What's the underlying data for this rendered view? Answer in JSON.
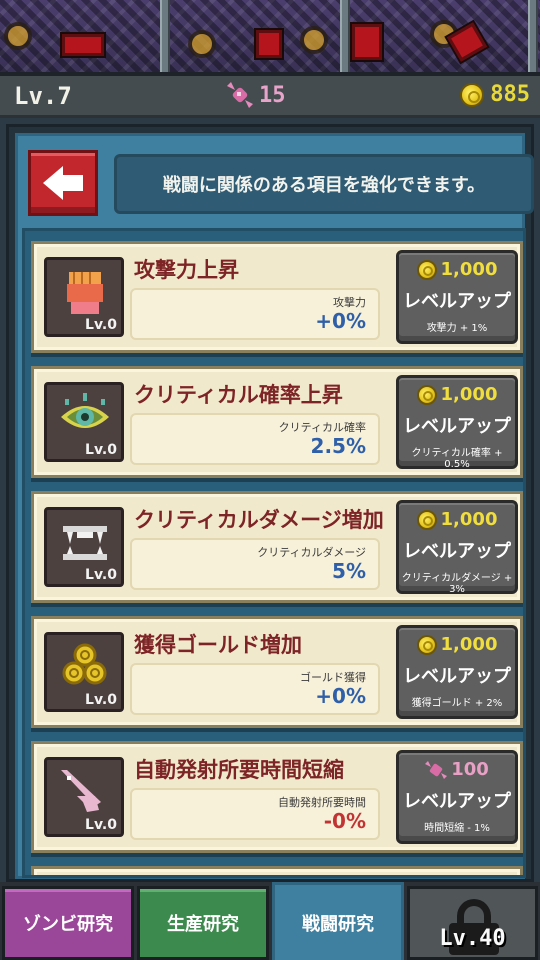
{
  "status": {
    "level": "Lv.7",
    "candy": "15",
    "gold": "885"
  },
  "header": {
    "info_text": "戦闘に関係のある項目を強化できます。"
  },
  "upgrades": [
    {
      "title": "攻撃力上昇",
      "icon": "fist-icon",
      "level": "Lv.0",
      "stat_label": "攻撃力",
      "stat_value": "+0%",
      "cost_currency": "gold",
      "cost": "1,000",
      "button_label": "レベルアップ",
      "effect": "攻撃力 + 1%"
    },
    {
      "title": "クリティカル確率上昇",
      "icon": "eye-icon",
      "level": "Lv.0",
      "stat_label": "クリティカル確率",
      "stat_value": "2.5%",
      "cost_currency": "gold",
      "cost": "1,000",
      "button_label": "レベルアップ",
      "effect": "クリティカル確率 + 0.5%"
    },
    {
      "title": "クリティカルダメージ増加",
      "icon": "fangs-icon",
      "level": "Lv.0",
      "stat_label": "クリティカルダメージ",
      "stat_value": "5%",
      "cost_currency": "gold",
      "cost": "1,000",
      "button_label": "レベルアップ",
      "effect": "クリティカルダメージ + 3%"
    },
    {
      "title": "獲得ゴールド増加",
      "icon": "coins-icon",
      "level": "Lv.0",
      "stat_label": "ゴールド獲得",
      "stat_value": "+0%",
      "cost_currency": "gold",
      "cost": "1,000",
      "button_label": "レベルアップ",
      "effect": "獲得ゴールド + 2%"
    },
    {
      "title": "自動発射所要時間短縮",
      "icon": "gun-icon",
      "level": "Lv.0",
      "stat_label": "自動発射所要時間",
      "stat_value": "-0%",
      "cost_currency": "candy",
      "cost": "100",
      "button_label": "レベルアップ",
      "effect": "時間短縮 - 1%"
    }
  ],
  "tabs": {
    "zombie": "ゾンビ研究",
    "production": "生産研究",
    "battle": "戦闘研究",
    "locked_level": "Lv.40"
  },
  "colors": {
    "gold_text": "#e8d93a",
    "candy_text": "#e7a3c9",
    "stat_positive": "#2e5fa8",
    "stat_negative": "#c23434",
    "card_title": "#7d2426"
  }
}
